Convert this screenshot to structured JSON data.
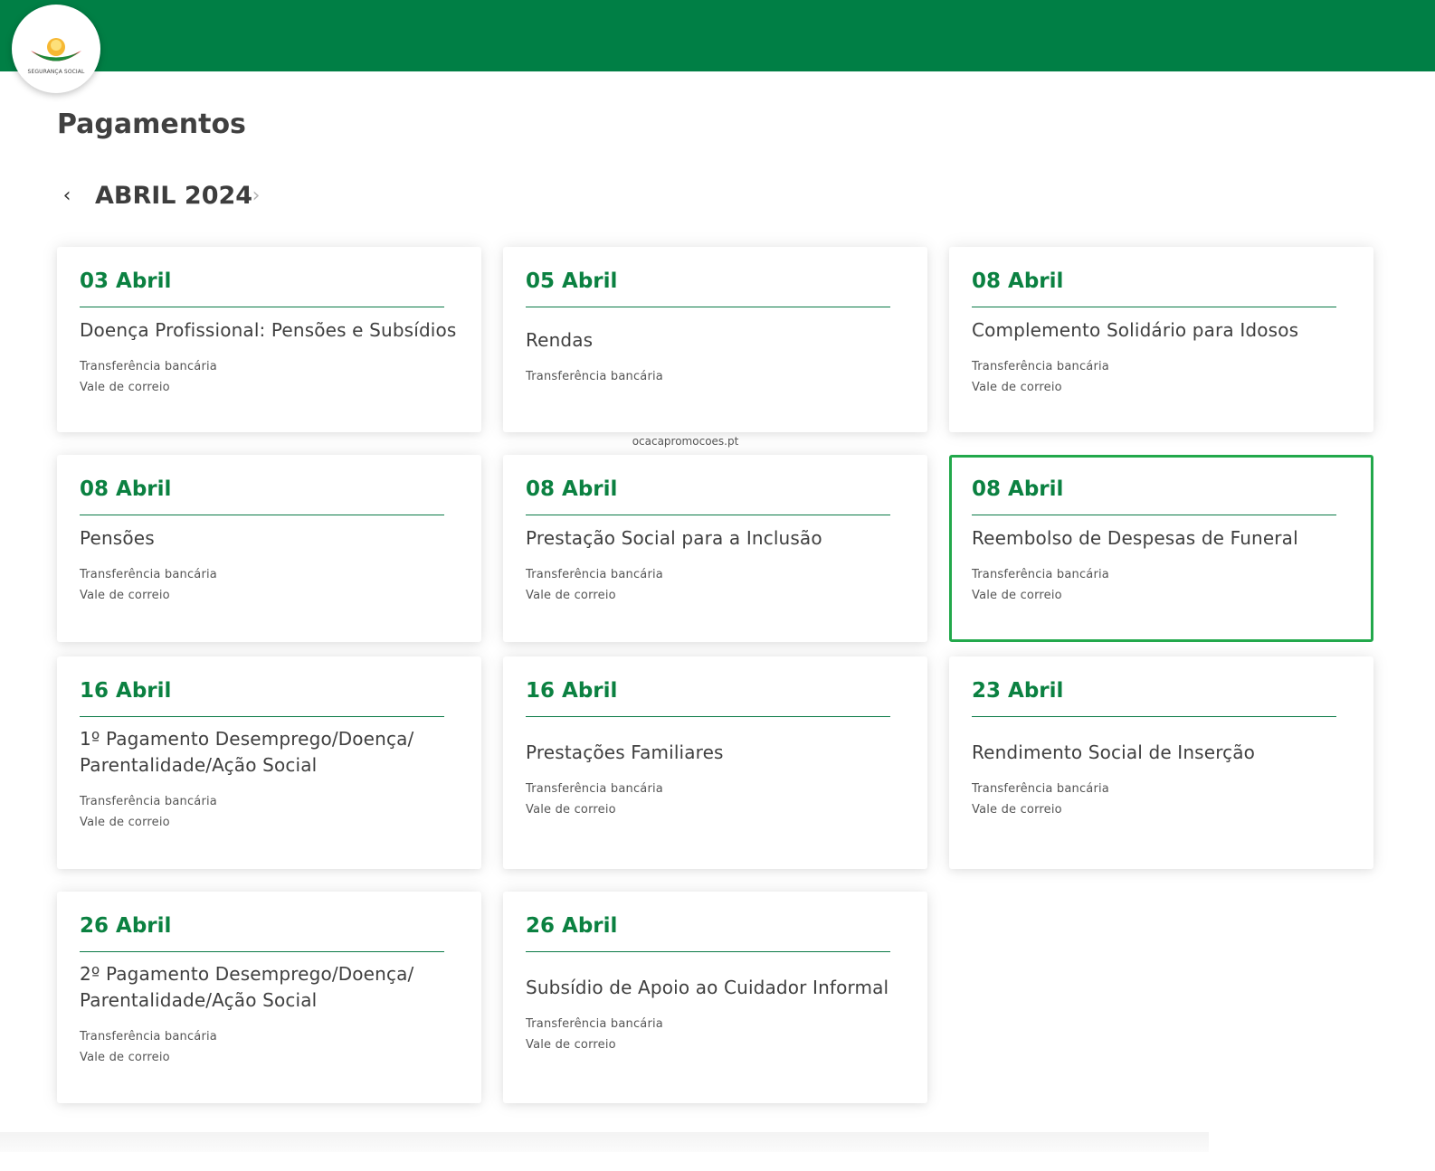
{
  "brand": {
    "logo_text": "SEGURANÇA SOCIAL",
    "primary_color": "#007f45",
    "accent_green": "#0b8141",
    "selected_outline_color": "#22a84b"
  },
  "page": {
    "title": "Pagamentos",
    "month": "ABRIL 2024",
    "prev_icon": "chevron-left-icon",
    "next_icon": "chevron-right-icon",
    "prev_symbol": "‹",
    "next_symbol": "›",
    "watermark": "ocacapromocoes.pt"
  },
  "payments": [
    {
      "date": "03 Abril",
      "title": "Doença Profissional: Pensões e Subsídios",
      "methods": [
        "Transferência bancária",
        "Vale de correio"
      ]
    },
    {
      "date": "05 Abril",
      "title": "Rendas",
      "methods": [
        "Transferência bancária"
      ]
    },
    {
      "date": "08 Abril",
      "title": "Complemento Solidário para Idosos",
      "methods": [
        "Transferência bancária",
        "Vale de correio"
      ]
    },
    {
      "date": "08 Abril",
      "title": "Pensões",
      "methods": [
        "Transferência bancária",
        "Vale de correio"
      ]
    },
    {
      "date": "08 Abril",
      "title": "Prestação Social para a Inclusão",
      "methods": [
        "Transferência bancária",
        "Vale de correio"
      ]
    },
    {
      "date": "08 Abril",
      "title": "Reembolso de Despesas de Funeral",
      "methods": [
        "Transferência bancária",
        "Vale de correio"
      ],
      "selected": true
    },
    {
      "date": "16 Abril",
      "title": "1º Pagamento Desemprego/Doença/ Parentalidade/Ação Social",
      "methods": [
        "Transferência bancária",
        "Vale de correio"
      ]
    },
    {
      "date": "16 Abril",
      "title": "Prestações Familiares",
      "methods": [
        "Transferência bancária",
        "Vale de correio"
      ]
    },
    {
      "date": "23 Abril",
      "title": "Rendimento Social de Inserção",
      "methods": [
        "Transferência bancária",
        "Vale de correio"
      ]
    },
    {
      "date": "26 Abril",
      "title": "2º Pagamento Desemprego/Doença/ Parentalidade/Ação Social",
      "methods": [
        "Transferência bancária",
        "Vale de correio"
      ]
    },
    {
      "date": "26 Abril",
      "title": "Subsídio de Apoio ao Cuidador Informal",
      "methods": [
        "Transferência bancária",
        "Vale de correio"
      ]
    }
  ]
}
